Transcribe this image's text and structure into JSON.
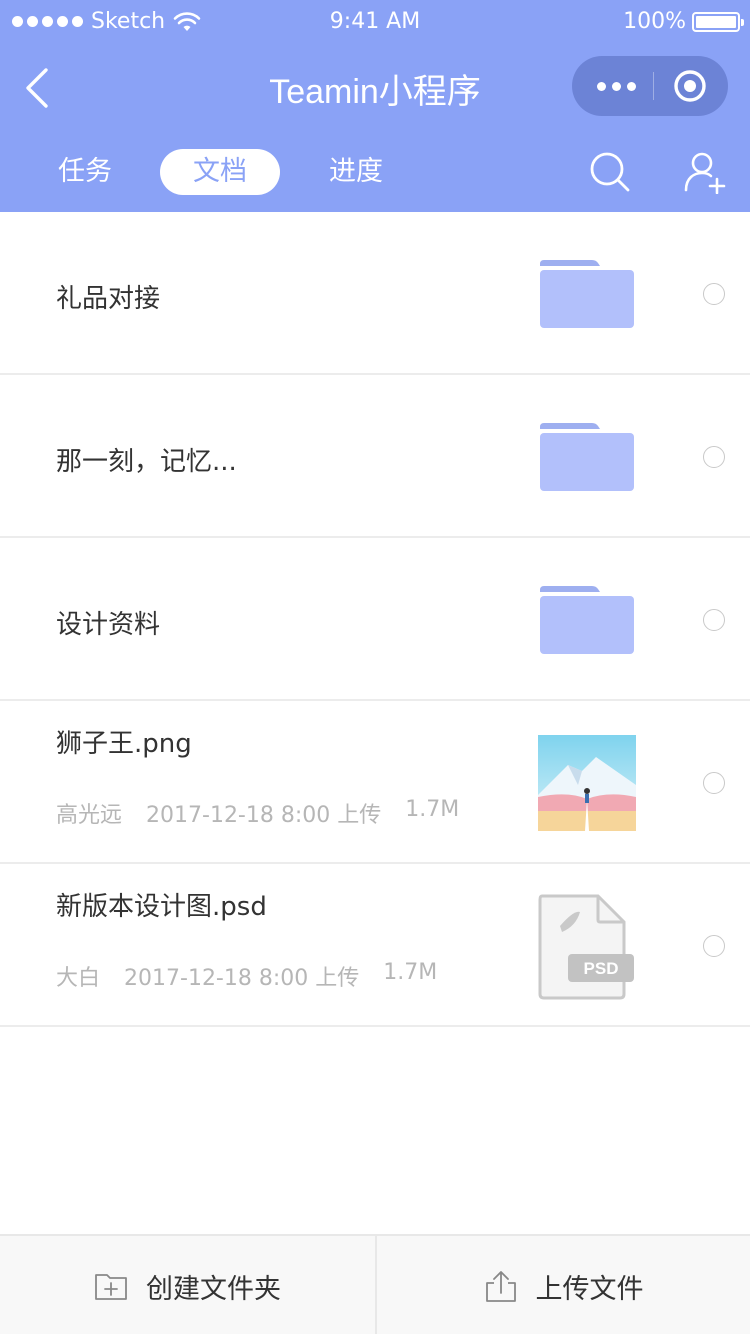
{
  "status_bar": {
    "carrier": "Sketch",
    "time": "9:41 AM",
    "battery": "100%"
  },
  "nav": {
    "title": "Teamin小程序"
  },
  "tabs": [
    {
      "label": "任务"
    },
    {
      "label": "文档",
      "active": true
    },
    {
      "label": "进度"
    }
  ],
  "items": [
    {
      "name": "礼品对接",
      "type": "folder"
    },
    {
      "name": "那一刻，记忆...",
      "type": "folder"
    },
    {
      "name": "设计资料",
      "type": "folder"
    },
    {
      "name": "狮子王.png",
      "type": "image",
      "uploader": "高光远",
      "uploaded": "2017-12-18 8:00 上传",
      "size": "1.7M"
    },
    {
      "name": "新版本设计图.psd",
      "type": "psd",
      "uploader": "大白",
      "uploaded": "2017-12-18 8:00 上传",
      "size": "1.7M",
      "badge": "PSD"
    }
  ],
  "bottom": {
    "new_folder": "创建文件夹",
    "upload": "上传文件"
  },
  "colors": {
    "accent": "#8aa2f6",
    "folder": "#b2c0fb",
    "folder_tab": "#9eaff0"
  }
}
